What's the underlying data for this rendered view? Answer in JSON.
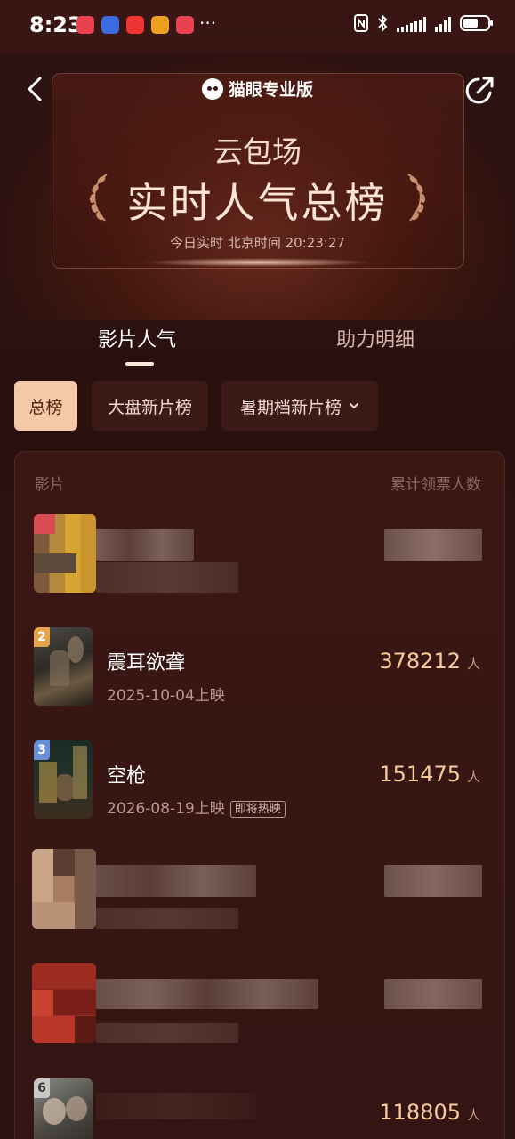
{
  "status_bar": {
    "time": "8:23",
    "dots": "···"
  },
  "header": {
    "brand": "猫眼专业版",
    "subtitle": "云包场",
    "title": "实时人气总榜",
    "realtime": "今日实时 北京时间 20:23:27",
    "back_icon": "chevron-left-icon",
    "share_icon": "share-icon"
  },
  "tabs": [
    {
      "label": "影片人气",
      "active": true
    },
    {
      "label": "助力明细",
      "active": false
    }
  ],
  "filters": [
    {
      "label": "总榜",
      "active": true
    },
    {
      "label": "大盘新片榜",
      "active": false
    },
    {
      "label": "暑期档新片榜",
      "active": false,
      "dropdown": true
    }
  ],
  "list": {
    "col_left": "影片",
    "col_right": "累计领票人数",
    "unit": "人",
    "rows": [
      {
        "rank": "2",
        "title": "震耳欲聋",
        "release": "2025-10-04上映",
        "count": "378212"
      },
      {
        "rank": "3",
        "title": "空枪",
        "release": "2026-08-19上映",
        "badge": "即将热映",
        "count": "151475"
      },
      {
        "rank": "6",
        "count": "118805"
      }
    ]
  },
  "colors": {
    "accent": "#f7ca9e",
    "chip_active": "#f2caa8",
    "background": "#2b1211"
  }
}
